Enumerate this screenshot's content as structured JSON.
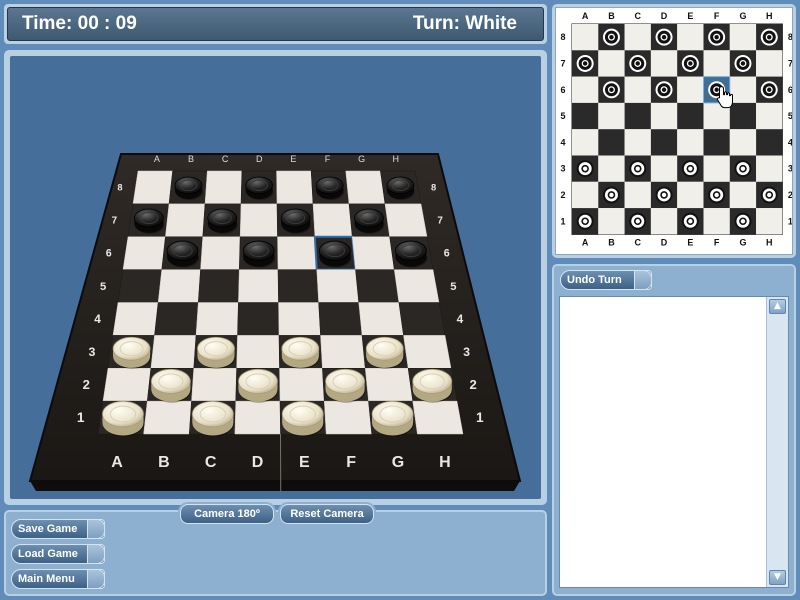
{
  "header": {
    "time_label": "Time:",
    "time_value": "00 : 09",
    "turn_label": "Turn:",
    "turn_value": "White"
  },
  "buttons": {
    "camera_180": "Camera 180º",
    "reset_camera": "Reset Camera",
    "save_game": "Save Game",
    "load_game": "Load Game",
    "main_menu": "Main Menu",
    "undo_turn": "Undo Turn"
  },
  "board": {
    "files": [
      "A",
      "B",
      "C",
      "D",
      "E",
      "F",
      "G",
      "H"
    ],
    "ranks": [
      "1",
      "2",
      "3",
      "4",
      "5",
      "6",
      "7",
      "8"
    ],
    "black_pieces": [
      "B8",
      "D8",
      "F8",
      "H8",
      "A7",
      "C7",
      "E7",
      "G7",
      "B6",
      "D6",
      "F6",
      "H6"
    ],
    "white_pieces": [
      "A1",
      "C1",
      "E1",
      "G1",
      "B2",
      "D2",
      "F2",
      "H2",
      "A3",
      "C3",
      "E3",
      "G3"
    ],
    "highlighted_square": "F6"
  },
  "colors": {
    "background": "#5f8cb8",
    "viewport_bg": "#456e9b",
    "panel_light": "#b9cfe2",
    "header_bg": "#4a667f",
    "highlight": "#2d6fa8"
  },
  "icons": {
    "cursor": "hand-pointer-icon",
    "scroll_up": "arrow-up-icon",
    "scroll_down": "arrow-down-icon"
  }
}
